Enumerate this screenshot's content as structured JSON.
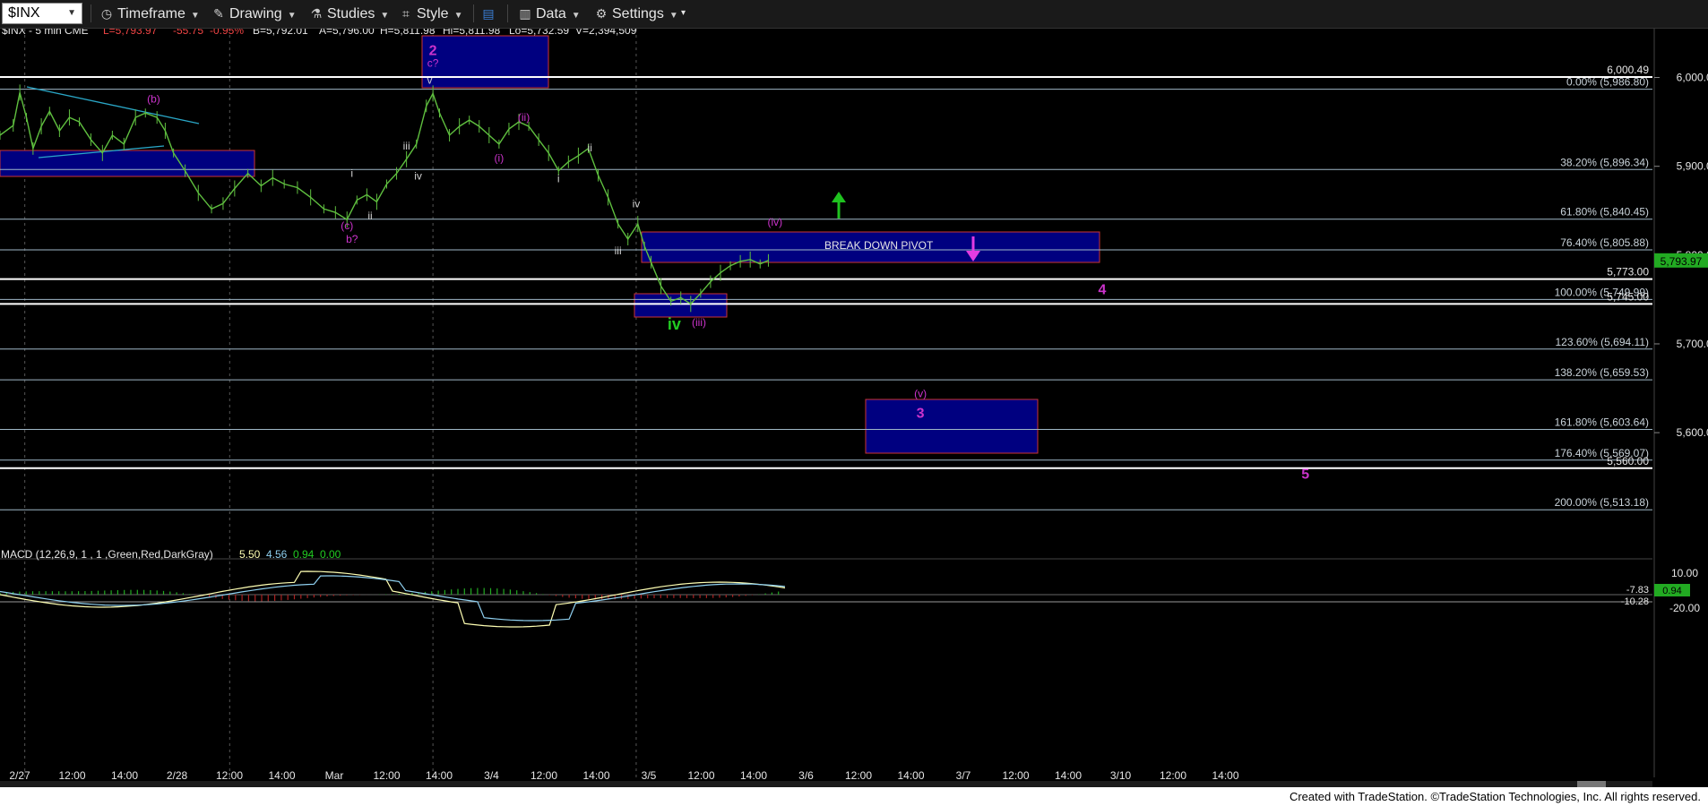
{
  "toolbar": {
    "symbol": "$INX",
    "timeframe": "Timeframe",
    "drawing": "Drawing",
    "studies": "Studies",
    "style": "Style",
    "data": "Data",
    "settings": "Settings"
  },
  "header": {
    "symbol": "$INX - 5 min  CME",
    "last": "L=5,793.97",
    "change": "-55.75",
    "pct": "-0.95%",
    "bid": "B=5,792.01",
    "ask": "A=5,796.00",
    "hi": "Hi=5,811.98",
    "lo": "Lo=5,732.59",
    "vol": "V=2,394,509",
    "hi_prev": "H=5,811.98"
  },
  "colors": {
    "up_bar": "#5fbf3f",
    "price_box": "#000080",
    "magenta": "#cc33cc",
    "green_label": "#22cc22",
    "fib_line": "#9fb7c7",
    "accent_last": "#22aa22"
  },
  "chart_data": {
    "type": "line",
    "title": "$INX - 5 min CME",
    "price_axis": {
      "ylim": [
        5470,
        6055
      ],
      "ticks": [
        "6,000.00",
        "5,900.00",
        "5,800.00",
        "5,700.00",
        "5,600.00"
      ]
    },
    "time_axis": {
      "labels": [
        "2/27",
        "12:00",
        "14:00",
        "2/28",
        "12:00",
        "14:00",
        "Mar",
        "12:00",
        "14:00",
        "3/4",
        "12:00",
        "14:00",
        "3/5",
        "12:00",
        "14:00",
        "3/6",
        "12:00",
        "14:00",
        "3/7",
        "12:00",
        "14:00",
        "3/10",
        "12:00",
        "14:00"
      ]
    },
    "last_price": "5,793.97",
    "fib_levels": [
      {
        "label": "0.00% (5,986.80)",
        "price": 5986.8
      },
      {
        "label": "38.20% (5,896.34)",
        "price": 5896.34
      },
      {
        "label": "61.80% (5,840.45)",
        "price": 5840.45
      },
      {
        "label": "76.40% (5,805.88)",
        "price": 5805.88
      },
      {
        "label": "100.00% (5,749.99)",
        "price": 5749.99
      },
      {
        "label": "123.60% (5,694.11)",
        "price": 5694.11
      },
      {
        "label": "138.20% (5,659.53)",
        "price": 5659.53
      },
      {
        "label": "161.80% (5,603.64)",
        "price": 5603.64
      },
      {
        "label": "176.40% (5,569.07)",
        "price": 5569.07
      },
      {
        "label": "200.00% (5,513.18)",
        "price": 5513.18
      }
    ],
    "hlines": [
      {
        "label": "6,000.49",
        "price": 6000.49
      },
      {
        "label": "5,773.00",
        "price": 5773.0
      },
      {
        "label": "5,745.00",
        "price": 5745.0
      },
      {
        "label": "5,560.00",
        "price": 5560.0
      }
    ],
    "wave_labels": [
      {
        "text": "2",
        "t": 0.262,
        "price": 6025
      },
      {
        "text": "c?",
        "t": 0.262,
        "price": 6012
      },
      {
        "text": "(b)",
        "t": 0.093,
        "price": 5972
      },
      {
        "text": "v",
        "t": 0.26,
        "price": 5993
      },
      {
        "text": "(ii)",
        "t": 0.317,
        "price": 5951
      },
      {
        "text": "(i)",
        "t": 0.302,
        "price": 5905
      },
      {
        "text": "ii",
        "t": 0.357,
        "price": 5917
      },
      {
        "text": "iii",
        "t": 0.246,
        "price": 5919
      },
      {
        "text": "iv",
        "t": 0.253,
        "price": 5885
      },
      {
        "text": "i",
        "t": 0.213,
        "price": 5888
      },
      {
        "text": "i",
        "t": 0.338,
        "price": 5882
      },
      {
        "text": "ii",
        "t": 0.224,
        "price": 5840
      },
      {
        "text": "(c)",
        "t": 0.21,
        "price": 5829
      },
      {
        "text": "b?",
        "t": 0.213,
        "price": 5814
      },
      {
        "text": "iv",
        "t": 0.385,
        "price": 5854
      },
      {
        "text": "iii",
        "t": 0.374,
        "price": 5801
      },
      {
        "text": "(iv)",
        "t": 0.469,
        "price": 5833
      },
      {
        "text": "iv",
        "t": 0.408,
        "price": 5716
      },
      {
        "text": "(iii)",
        "t": 0.423,
        "price": 5720
      },
      {
        "text": "(v)",
        "t": 0.557,
        "price": 5640
      },
      {
        "text": "3",
        "t": 0.557,
        "price": 5617
      },
      {
        "text": "4",
        "t": 0.667,
        "price": 5756
      },
      {
        "text": "5",
        "t": 0.79,
        "price": 5548
      }
    ],
    "annotations": [
      {
        "text": "BREAK DOWN PIVOT",
        "t": 0.523,
        "price": 5830
      }
    ],
    "macd": {
      "label": "MACD (12,26,9, 1 , 1 ,Green,Red,DarkGray)",
      "values": [
        "5.50",
        "4.56",
        "0.94",
        "0.00"
      ],
      "ticks": [
        "10.00",
        "-20.00"
      ],
      "right_values": [
        "-7.83",
        "0.94",
        "-10.28"
      ]
    }
  },
  "footer": {
    "credit": "Created with TradeStation. ©TradeStation Technologies, Inc. All rights reserved."
  }
}
